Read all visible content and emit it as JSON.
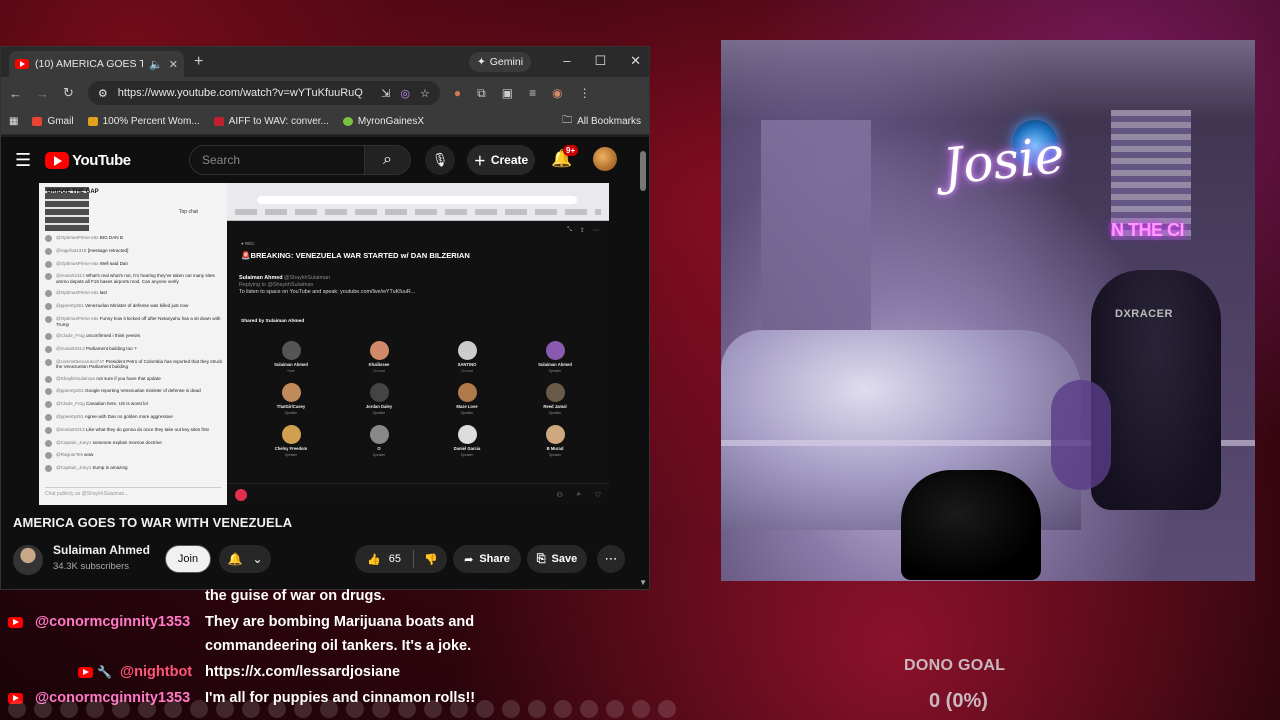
{
  "browser": {
    "tab_title": "(10) AMERICA GOES TO WA",
    "new_tab": "+",
    "gemini_label": "Gemini",
    "url": "https://www.youtube.com/watch?v=wYTuKfuuRuQ",
    "bookmarks": [
      "Gmail",
      "100% Percent Wom...",
      "AIFF to WAV: conver...",
      "MyronGainesX"
    ],
    "all_bookmarks": "All Bookmarks",
    "window_controls": [
      "–",
      "☐",
      "✕"
    ]
  },
  "youtube": {
    "logo": "YouTube",
    "search_placeholder": "Search",
    "create_label": "Create",
    "notif_badge": "9+",
    "video": {
      "space_rec": "● REC",
      "space_title": "🚨BREAKING: VENEZUELA WAR STARTED w/ DAN BILZERIAN",
      "host_name": "Sulaiman Ahmed",
      "host_handle": "@ShaykhSulaiman",
      "host_reply": "Replying to @ShaykhSulaiman",
      "host_text": "To listen to space on YouTube and speak: youtube.com/live/wYTuKfuuR...",
      "shared_by": "Shared by Sulaiman Ahmed",
      "chat_top_label": "Top chat",
      "chat_banner": "BRIDGE THE GAP",
      "chat_input": "Chat publicly as @ShaykhSulaiman...",
      "chat_rows": [
        {
          "name": "@OptimusPrime-x5x",
          "text": "BIG DAN B"
        },
        {
          "name": "@ragehat1318",
          "text": "[message retracted]"
        },
        {
          "name": "@OptimusPrime-x5x",
          "text": "Well said Dan"
        },
        {
          "name": "@mosa02313",
          "text": "What's real what's not, I'm hearing they've taken out many sites ammo depots all F16 bases airports mod. Can anyone verify"
        },
        {
          "name": "@OptimusPrime-x5x",
          "text": "last"
        },
        {
          "name": "@ppeerty261",
          "text": "Venezuelan Minister of defense was killed just now"
        },
        {
          "name": "@OptimusPrime-x5x",
          "text": "Funny how it kicked off after Netanyahu has a sit down with Trump"
        },
        {
          "name": "@Clade_Frog",
          "text": "unconfirmed i think yeesirs"
        },
        {
          "name": "@mosa02313",
          "text": "Parliament building too ?"
        },
        {
          "name": "@committeecarusol747",
          "text": "President Petro of Colombia has reported that they struck the Venezuelan Parliament building"
        },
        {
          "name": "@ShaykhSulaiman",
          "text": "not sure if you have that update"
        },
        {
          "name": "@ppeerty261",
          "text": "Google reporting Venezuelan minister of defense is dead"
        },
        {
          "name": "@Clade_Frog",
          "text": "Canadian here, US is worst lol"
        },
        {
          "name": "@ppeerty261",
          "text": "Agree with Dan no golden more aggressive"
        },
        {
          "name": "@mosa02313",
          "text": "Like what they do gonna do once they take out key sites first"
        },
        {
          "name": "@Captain_Joey1",
          "text": "someone explain monroe doctrine"
        },
        {
          "name": "@RagnarTek",
          "text": "wow"
        },
        {
          "name": "@Captain_Joey1",
          "text": "trump is amazing"
        }
      ],
      "speakers": [
        {
          "name": "Sulaiman Ahmed",
          "role": "Host",
          "color": "#555"
        },
        {
          "name": "Khaliissee",
          "role": "Co-host",
          "color": "#d08a6a"
        },
        {
          "name": "SANTINO",
          "role": "Co-host",
          "color": "#ccc"
        },
        {
          "name": "Sulaiman Ahmed",
          "role": "Speaker",
          "color": "#8a5ab0"
        },
        {
          "name": "ThatGirlCasey",
          "role": "Speaker",
          "color": "#c08a5a"
        },
        {
          "name": "Jordan Daley",
          "role": "Speaker",
          "color": "#444"
        },
        {
          "name": "Maze Love",
          "role": "Speaker",
          "color": "#b07a4a"
        },
        {
          "name": "Reed Jamal",
          "role": "Speaker",
          "color": "#6a5a4a"
        },
        {
          "name": "Chelsy Freedom",
          "role": "Speaker",
          "color": "#d0a050"
        },
        {
          "name": "O",
          "role": "Speaker",
          "color": "#888"
        },
        {
          "name": "Daniel Garcia",
          "role": "Speaker",
          "color": "#ddd"
        },
        {
          "name": "B Murad",
          "role": "Speaker",
          "color": "#d0a880"
        }
      ]
    },
    "title": "AMERICA GOES TO WAR WITH VENEZUELA",
    "channel_name": "Sulaiman Ahmed",
    "subscribers": "34.3K subscribers",
    "join_label": "Join",
    "likes": "65",
    "share_label": "Share",
    "save_label": "Save"
  },
  "overlay_chat": {
    "line0": "the guise of war on drugs.",
    "line1_user": "@conormcginnity1353",
    "line1_msg": "They are bombing Marijuana boats and",
    "line2_msg": "commandeering oil tankers. It's a joke.",
    "line3_user": "@nightbot",
    "line3_msg": "https://x.com/lessardjosiane",
    "line4_user": "@conormcginnity1353",
    "line4_msg": "I'm all for puppies and cinnamon rolls!!"
  },
  "webcam": {
    "neon_name": "Josie",
    "neon_sign": "N THE CI",
    "chair_brand": "DXRACER"
  },
  "dono_goal": {
    "label": "DONO GOAL",
    "value": "0 (0%)"
  }
}
